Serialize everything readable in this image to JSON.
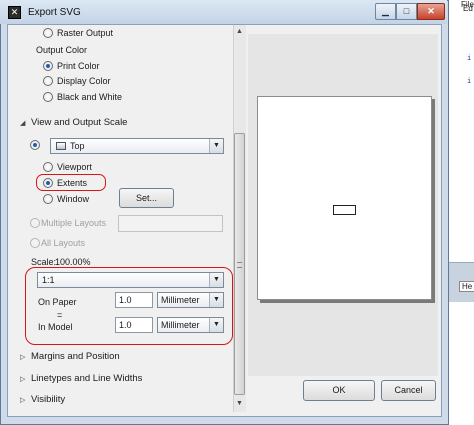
{
  "window": {
    "title": "Export SVG"
  },
  "background_app": {
    "menu_file": "File",
    "menu_edit": "Ed",
    "code_lines": [
      "i",
      "i"
    ],
    "tab_label": "He"
  },
  "output_type": {
    "raster_output": "Raster Output"
  },
  "output_color": {
    "heading": "Output Color",
    "options": [
      "Print Color",
      "Display Color",
      "Black and White"
    ],
    "selected": "Print Color"
  },
  "view_scale": {
    "heading": "View and Output Scale",
    "viewport_selected": "Top",
    "options": {
      "viewport": "Viewport",
      "extents": "Extents",
      "window": "Window",
      "multiple_layouts": "Multiple Layouts",
      "all_layouts": "All Layouts"
    },
    "selected": "Extents",
    "set_button": "Set...",
    "scale_label": "Scale:",
    "scale_value": "100.00%",
    "ratio": "1:1",
    "on_paper_label": "On Paper",
    "equals": "=",
    "in_model_label": "In Model",
    "on_paper_value": "1.0",
    "on_paper_unit": "Millimeter",
    "in_model_value": "1.0",
    "in_model_unit": "Millimeter"
  },
  "sections": {
    "margins": "Margins and Position",
    "linetypes": "Linetypes and Line Widths",
    "visibility": "Visibility"
  },
  "buttons": {
    "ok": "OK",
    "cancel": "Cancel"
  },
  "colors": {
    "annotation_red": "#d8141b",
    "selection_blue": "#1f5fa8"
  }
}
